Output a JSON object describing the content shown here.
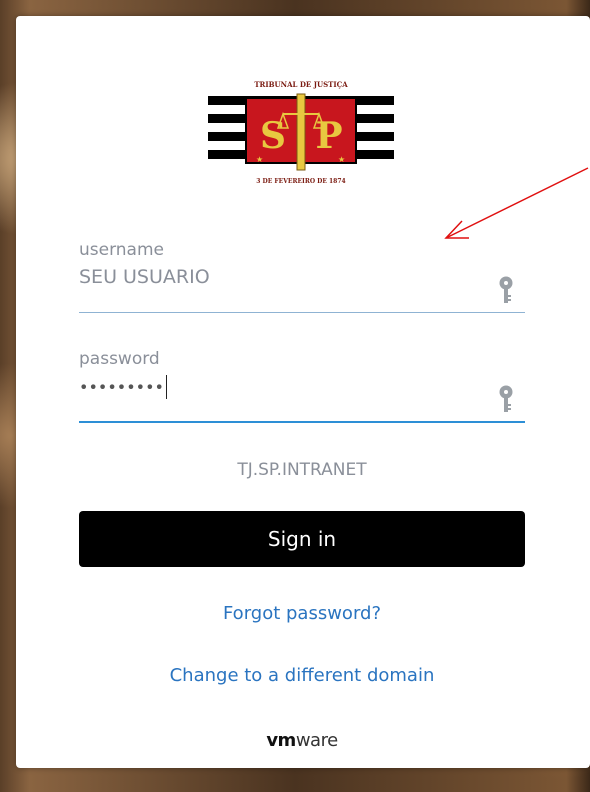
{
  "logo": {
    "top_text": "TRIBUNAL DE JUSTIÇA",
    "bottom_text": "3 DE FEVEREIRO DE 1874",
    "letters": [
      "S",
      "P"
    ]
  },
  "username": {
    "label": "username",
    "value": "SEU USUARIO"
  },
  "password": {
    "label": "password",
    "value": "•••••••••"
  },
  "domain": "TJ.SP.INTRANET",
  "signin_label": "Sign in",
  "forgot_label": "Forgot password?",
  "change_domain_label": "Change to a different domain",
  "brand": {
    "vm": "vm",
    "ware": "ware"
  },
  "colors": {
    "accent_link": "#2a74c0",
    "focus_underline": "#2d8fd6",
    "arrow": "#e01010"
  }
}
